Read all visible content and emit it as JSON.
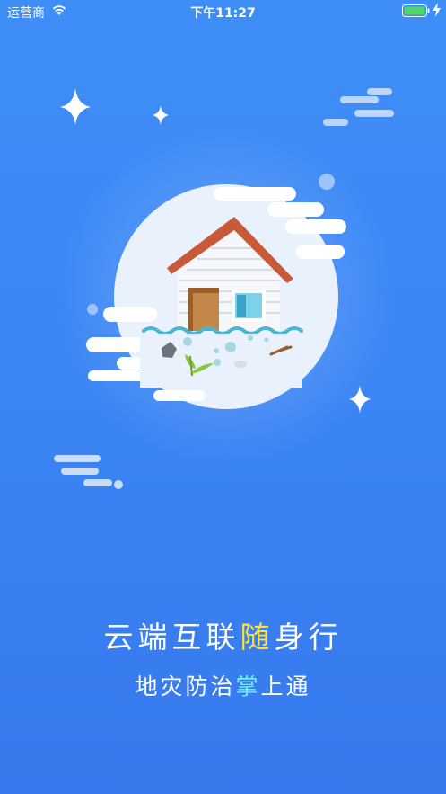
{
  "status_bar": {
    "carrier": "运营商",
    "time": "下午11:27"
  },
  "slogan": {
    "main_part1": "云端互联",
    "main_highlight": "随",
    "main_part2": "身行",
    "sub_part1": "地灾防治",
    "sub_highlight": "掌",
    "sub_part2": "上通"
  },
  "colors": {
    "background_top": "#3f8ef7",
    "background_bottom": "#3679ee",
    "highlight_yellow": "#ffe033",
    "highlight_cyan": "#6ff2f2",
    "battery_green": "#4cd964"
  },
  "icons": [
    "wifi-icon",
    "battery-icon",
    "charging-icon",
    "sparkle-icon",
    "cloud-icon",
    "flooded-house-illustration"
  ]
}
